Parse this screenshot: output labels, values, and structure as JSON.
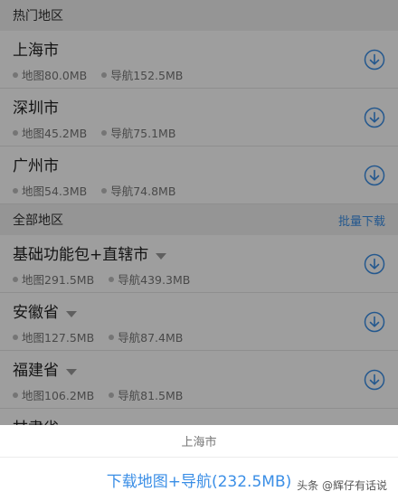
{
  "hot_section": {
    "title": "热门地区",
    "items": [
      {
        "name": "上海市",
        "map_label": "地图80.0MB",
        "nav_label": "导航152.5MB"
      },
      {
        "name": "深圳市",
        "map_label": "地图45.2MB",
        "nav_label": "导航75.1MB"
      },
      {
        "name": "广州市",
        "map_label": "地图54.3MB",
        "nav_label": "导航74.8MB"
      }
    ]
  },
  "all_section": {
    "title": "全部地区",
    "action": "批量下载",
    "items": [
      {
        "name": "基础功能包+直辖市",
        "map_label": "地图291.5MB",
        "nav_label": "导航439.3MB"
      },
      {
        "name": "安徽省",
        "map_label": "地图127.5MB",
        "nav_label": "导航87.4MB"
      },
      {
        "name": "福建省",
        "map_label": "地图106.2MB",
        "nav_label": "导航81.5MB"
      },
      {
        "name": "甘肃省"
      }
    ]
  },
  "sheet": {
    "title": "上海市",
    "action": "下载地图+导航(232.5MB)"
  },
  "watermark": "头条 @辉仔有话说",
  "colors": {
    "accent": "#3a8ee6",
    "overlay": "rgba(0,0,0,0.38)"
  },
  "icons": {
    "download": "download-circle-icon",
    "expand": "caret-down-icon"
  }
}
